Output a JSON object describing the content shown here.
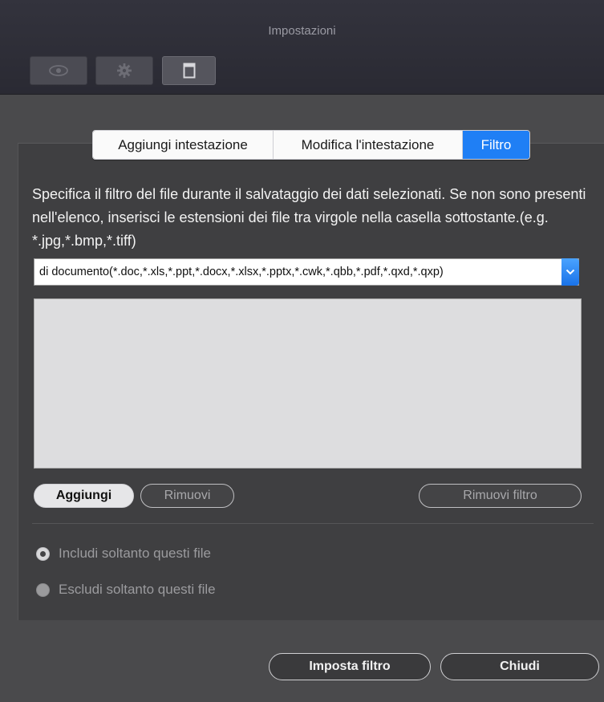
{
  "window": {
    "title": "Impostazioni"
  },
  "toolbar": {
    "items": [
      {
        "icon": "eye-icon"
      },
      {
        "icon": "gear-icon"
      },
      {
        "icon": "window-icon"
      }
    ]
  },
  "tabs": [
    {
      "label": "Aggiungi intestazione",
      "selected": false
    },
    {
      "label": "Modifica l'intestazione",
      "selected": false
    },
    {
      "label": "Filtro",
      "selected": true
    }
  ],
  "filter": {
    "description": "Specifica il filtro del file durante il salvataggio dei dati selezionati. Se non sono presenti nell'elenco, inserisci le estensioni dei file tra virgole nella casella sottostante.(e.g. *.jpg,*.bmp,*.tiff)",
    "combo_value": "di documento(*.doc,*.xls,*.ppt,*.docx,*.xlsx,*.pptx,*.cwk,*.qbb,*.pdf,*.qxd,*.qxp)",
    "add_label": "Aggiungi",
    "remove_label": "Rimuovi",
    "remove_filter_label": "Rimuovi filtro",
    "include_label": "Includi soltanto questi file",
    "exclude_label": "Escludi soltanto questi file",
    "selected_mode": "include"
  },
  "footer": {
    "set_filter_label": "Imposta filtro",
    "close_label": "Chiudi"
  },
  "colors": {
    "accent": "#1f7ff5",
    "background": "#4a4a4c"
  }
}
